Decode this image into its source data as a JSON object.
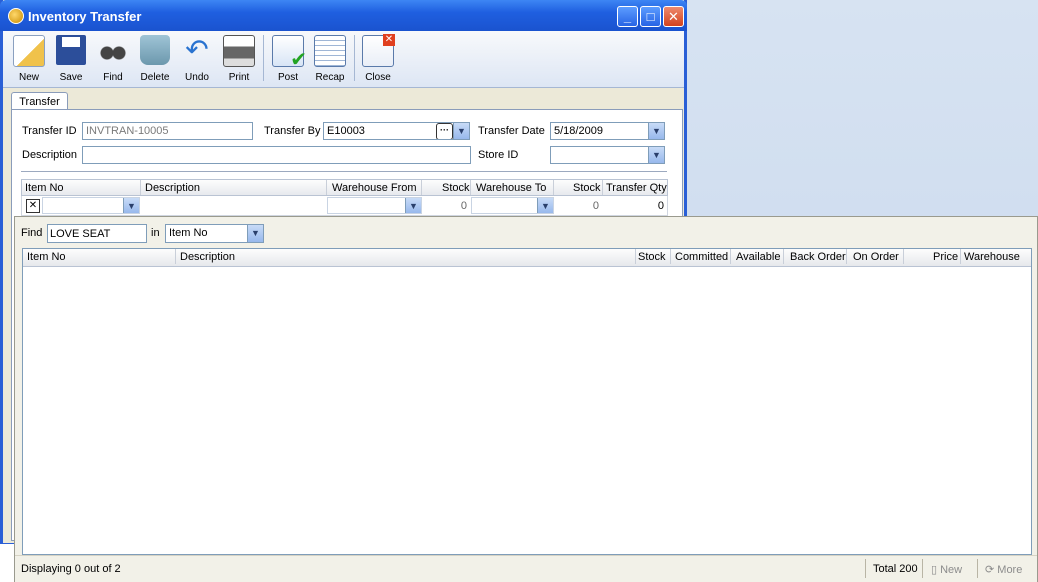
{
  "window": {
    "title": "Inventory Transfer",
    "controls": {
      "minimize": "_",
      "maximize": "□",
      "close": "✕"
    }
  },
  "toolbar": {
    "new": "New",
    "save": "Save",
    "find": "Find",
    "delete": "Delete",
    "undo": "Undo",
    "print": "Print",
    "post": "Post",
    "recap": "Recap",
    "close": "Close"
  },
  "tab": {
    "label": "Transfer"
  },
  "form": {
    "transfer_id_label": "Transfer ID",
    "transfer_id_value": "INVTRAN-10005",
    "transfer_by_label": "Transfer By",
    "transfer_by_value": "E10003",
    "transfer_date_label": "Transfer Date",
    "transfer_date_value": "5/18/2009",
    "description_label": "Description",
    "description_value": "",
    "store_id_label": "Store ID",
    "store_id_value": ""
  },
  "grid": {
    "headers": [
      "Item No",
      "Description",
      "Warehouse From",
      "Stock",
      "Warehouse To",
      "Stock",
      "Transfer Qty"
    ],
    "row": {
      "stock_from": "0",
      "stock_to": "0",
      "transfer_qty": "0"
    }
  },
  "lookup": {
    "find_label": "Find",
    "find_value": "LOVE SEAT",
    "in_label": "in",
    "in_value": "Item No",
    "columns": [
      "Item No",
      "Description",
      "Stock",
      "Committed",
      "Available",
      "Back Order",
      "On Order",
      "Price",
      "Warehouse"
    ],
    "status_text": "Displaying 0 out of 2",
    "total_text": "Total 200",
    "new_label": "New",
    "more_label": "More"
  },
  "icons": {
    "dropdown": "▼",
    "ellipsis": "···",
    "remove": "✕"
  }
}
